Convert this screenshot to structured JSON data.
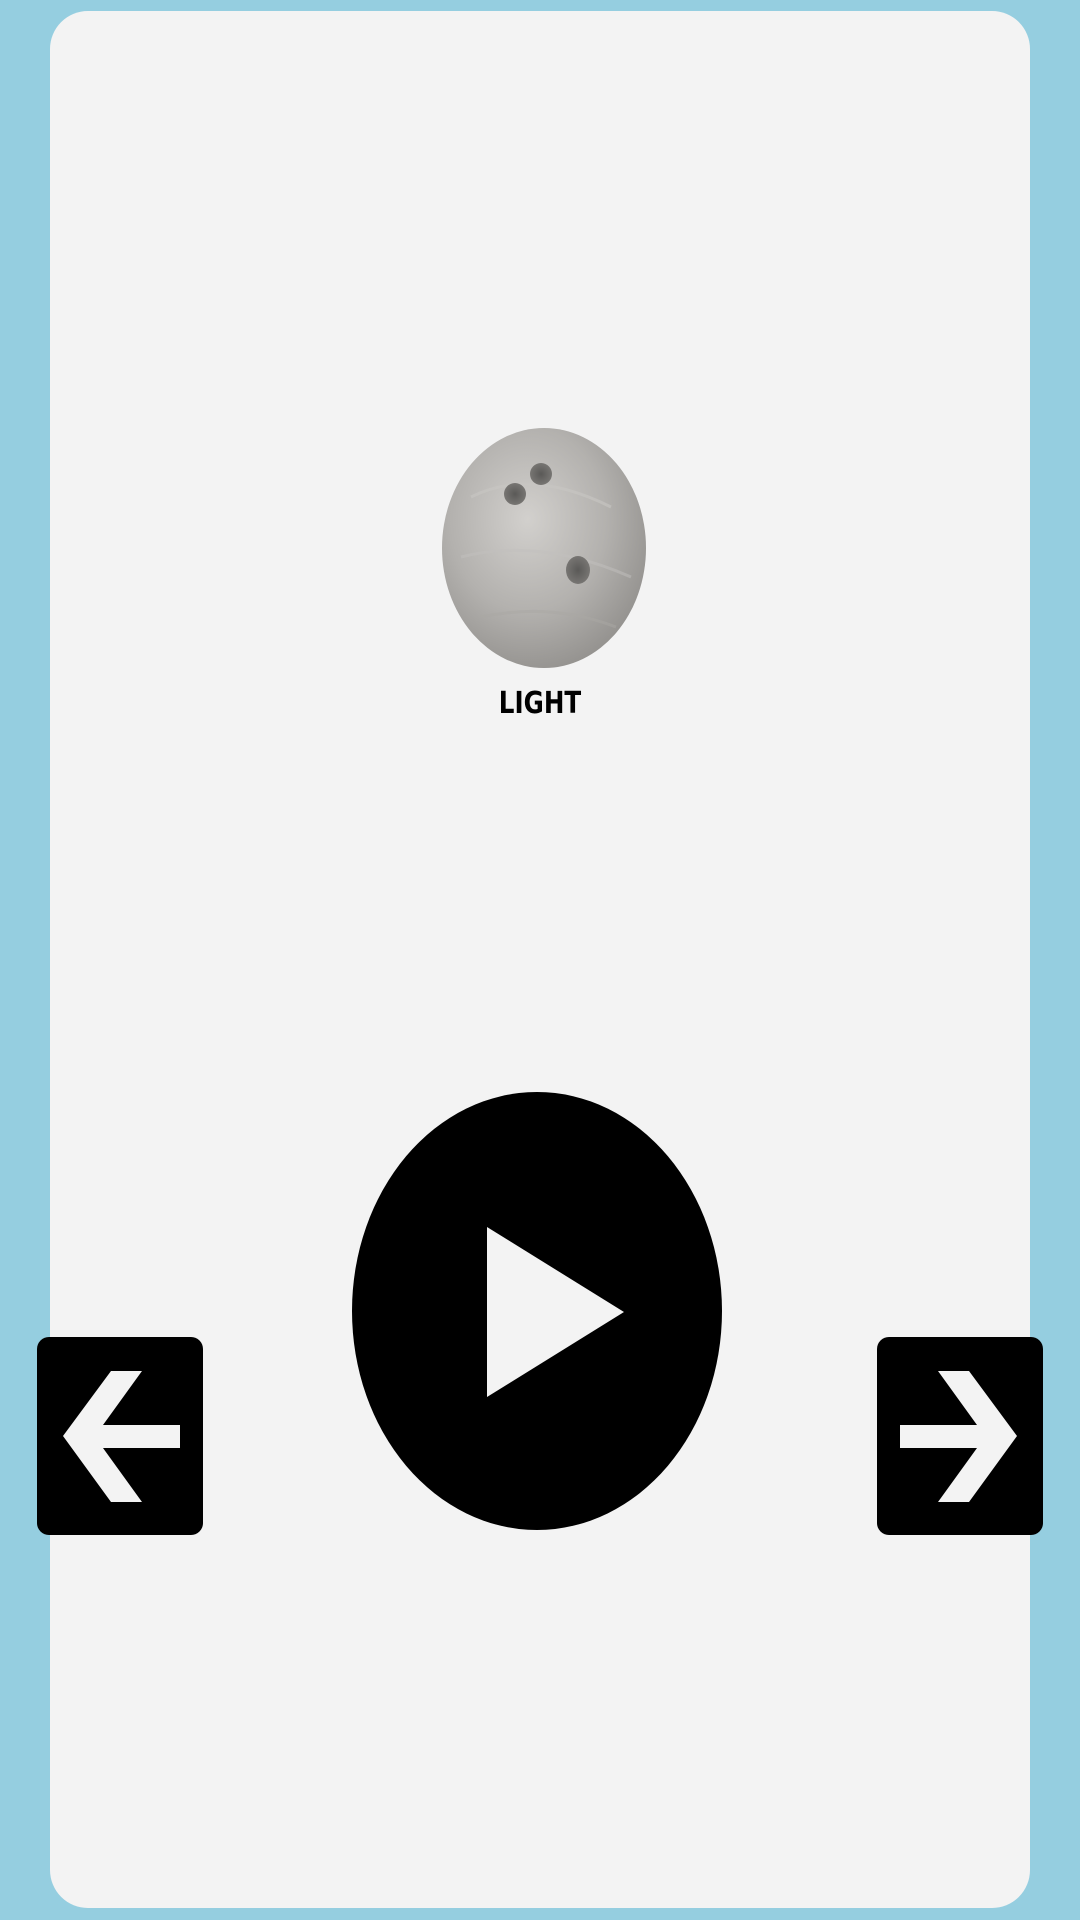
{
  "ball": {
    "label": "LIGHT",
    "icon": "bowling-ball-icon",
    "color": "#b3b1ae"
  },
  "controls": {
    "play_icon": "play-icon",
    "prev_icon": "arrow-left-icon",
    "next_icon": "arrow-right-icon"
  },
  "colors": {
    "background": "#95cee0",
    "panel": "#f3f3f3",
    "button": "#000000",
    "button_icon": "#ffffff"
  }
}
